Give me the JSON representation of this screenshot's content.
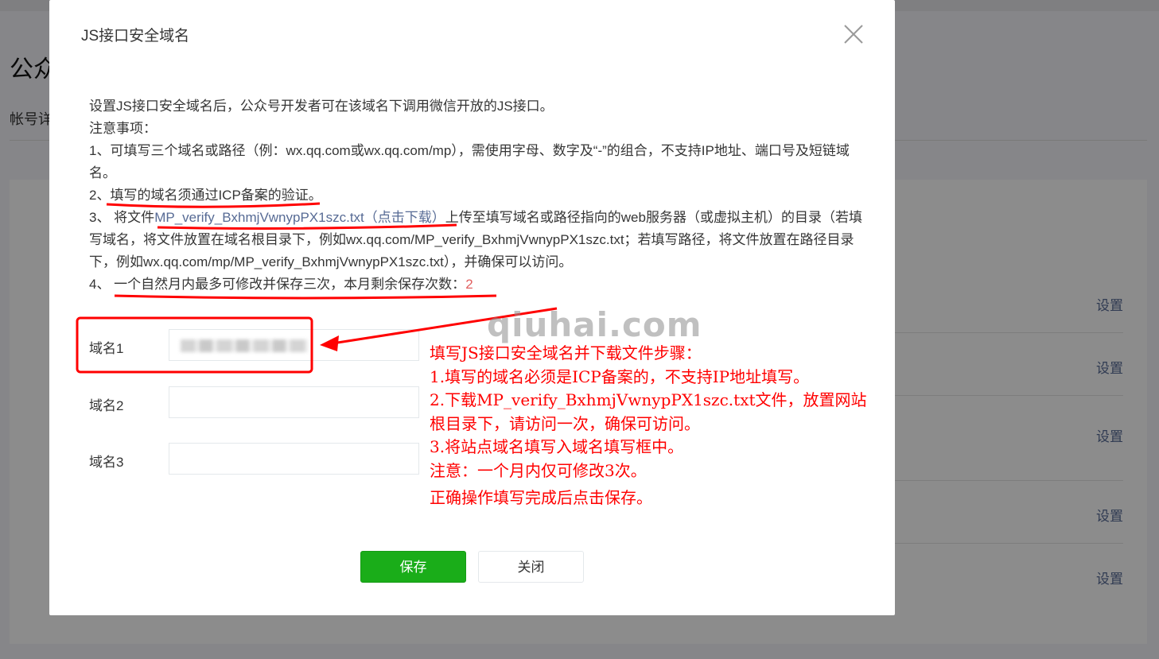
{
  "background": {
    "page_title": "公众",
    "tab_label": "帐号详",
    "settings": [
      "设置",
      "设置",
      "设置",
      "设置",
      "设置"
    ]
  },
  "dialog": {
    "title": "JS接口安全域名",
    "intro": "设置JS接口安全域名后，公众号开发者可在该域名下调用微信开放的JS接口。",
    "notes_heading": "注意事项：",
    "note1": "1、可填写三个域名或路径（例：wx.qq.com或wx.qq.com/mp），需使用字母、数字及“-”的组合，不支持IP地址、端口号及短链域名。",
    "note2": "2、填写的域名须通过ICP备案的验证。",
    "note3_prefix": "3、 将文件",
    "note3_link": "MP_verify_BxhmjVwnypPX1szc.txt（点击下载）",
    "note3_suffix": "上传至填写域名或路径指向的web服务器（或虚拟主机）的目录（若填写域名，将文件放置在域名根目录下，例如wx.qq.com/MP_verify_BxhmjVwnypPX1szc.txt；若填写路径，将文件放置在路径目录下，例如wx.qq.com/mp/MP_verify_BxhmjVwnypPX1szc.txt），并确保可以访问。",
    "note4_prefix": "4、 一个自然月内最多可修改并保存三次，本月剩余保存次数：",
    "note4_count": "2",
    "fields": [
      {
        "label": "域名1",
        "value": "",
        "placeholder": ""
      },
      {
        "label": "域名2",
        "value": "",
        "placeholder": ""
      },
      {
        "label": "域名3",
        "value": "",
        "placeholder": ""
      }
    ],
    "save_label": "保存",
    "close_label": "关闭",
    "close_icon": "close-icon"
  },
  "annotation": {
    "watermark": "qiuhai.com",
    "lines": [
      "填写JS接口安全域名并下载文件步骤：",
      "1.填写的域名必须是ICP备案的，不支持IP地址填写。",
      "2.下载MP_verify_BxhmjVwnypPX1szc.txt文件，放置网站根目录下，请访问一次，确保可访问。",
      "3.将站点域名填写入域名填写框中。",
      "注意：一个月内仅可修改3次。",
      "正确操作填写完成后点击保存。"
    ],
    "color": "#ff0000"
  },
  "colors": {
    "primary_green": "#1aad19",
    "link_blue": "#576b95",
    "remaining_red": "#e15f5f"
  }
}
